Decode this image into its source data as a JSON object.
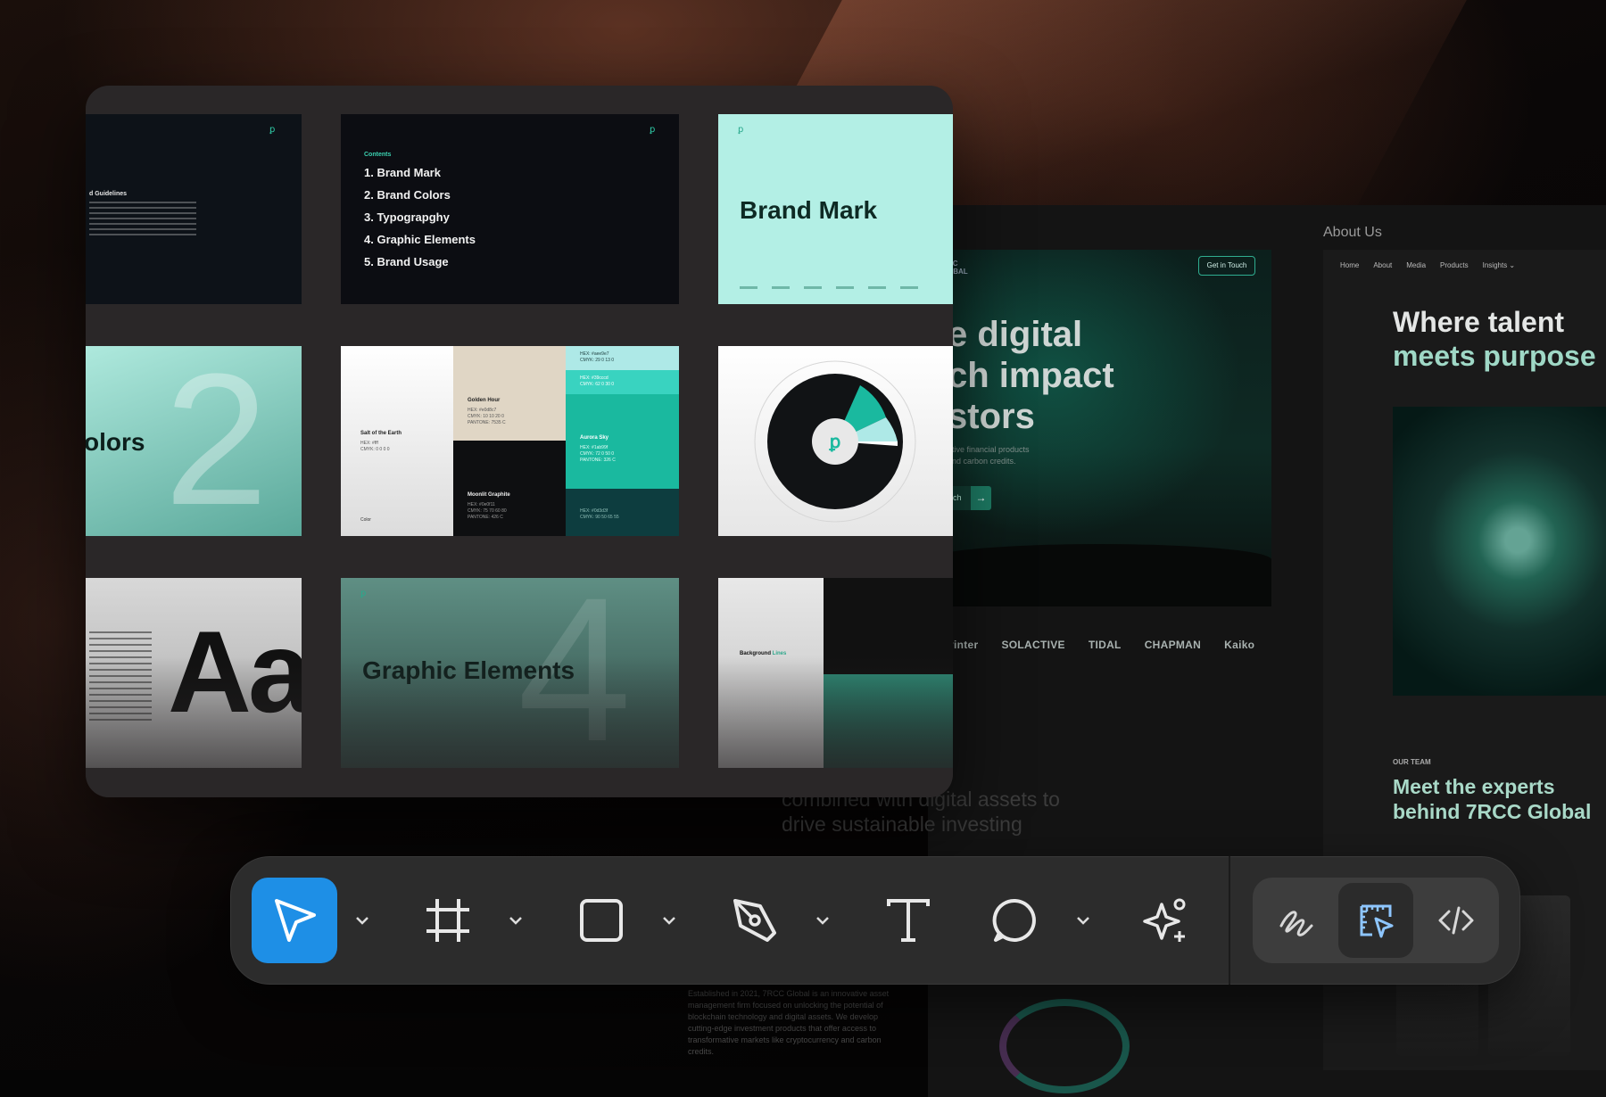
{
  "colors": {
    "accent": "#1e8fe6",
    "teal": "#2fc7a4",
    "mint": "#b3efe5"
  },
  "slides": {
    "intro": {
      "title": "d Guidelines"
    },
    "contents": {
      "label": "Contents",
      "items": [
        "1. Brand Mark",
        "2. Brand Colors",
        "3. Typograpghy",
        "4. Graphic Elements",
        "5. Brand Usage"
      ]
    },
    "brand_mark": {
      "title": "Brand Mark"
    },
    "colors": {
      "number": "2",
      "word": "olors"
    },
    "palette": {
      "salt": {
        "name": "Salt of the Earth",
        "hex": "HEX: #fff",
        "cmyk": "CMYK: 0 0 0 0"
      },
      "golden": {
        "name": "Golden Hour",
        "hex": "HEX: #e0d8c7",
        "cmyk": "CMYK: 10 10 20 0",
        "pantone": "PANTONE: 7535 C"
      },
      "moonlit": {
        "name": "Moonlit Graphite",
        "hex": "HEX: #0e0f11",
        "cmyk": "CMYK: 75 70 60 80",
        "pantone": "PANTONE: 426 C"
      },
      "aurora": {
        "name": "Aurora Sky",
        "hex": "HEX: #1ab99f",
        "cmyk": "CMYK: 72 0 50 0",
        "pantone": "PANTONE: 326 C"
      },
      "swatch1": "HEX: #aee9e7",
      "swatch1_cmyk": "CMYK: 29 0 13 0",
      "swatch2": "HEX: #39cccd",
      "swatch2_cmyk": "CMYK: 62 0 30 0",
      "swatch3": "HEX: #0d3d3f",
      "swatch3_cmyk": "CMYK: 90 50 65 55",
      "footer": "Color"
    },
    "type": {
      "glyph": "Aa"
    },
    "graphic": {
      "title": "Graphic Elements",
      "number": "4"
    },
    "background": {
      "title_a": "Background ",
      "title_b": "Lines"
    }
  },
  "website": {
    "logo_tag": "CC\nOBAL",
    "cta": "Get in Touch",
    "hero_title": "e digital\nch impact\nstors",
    "hero_sub": "ative financial products\nand carbon credits.",
    "hero_btn": "ch",
    "hero_arrow": "→",
    "partners": [
      "vinter",
      "SOLACTIVE",
      "TIDAL",
      "CHAPMAN",
      "Kaiko"
    ],
    "frontier": "new frontier\nedits are\ncombined with digital assets to\ndrive sustainable investing",
    "caption": "Established in 2021, 7RCC Global is an innovative asset management firm focused on unlocking the potential of blockchain technology and digital assets. We develop cutting-edge investment products that offer access to transformative markets like cryptocurrency and carbon credits.",
    "about_label": "About Us",
    "about_nav": [
      "Home",
      "About",
      "Media",
      "Products",
      "Insights ⌄"
    ],
    "talent_a": "Where talent",
    "talent_b": "meets purpose",
    "our_team": "OUR TEAM",
    "experts": "Meet the experts\nbehind 7RCC Global"
  },
  "toolbar": {
    "tools": [
      "move-tool",
      "frame-tool",
      "shape-tool",
      "pen-tool",
      "text-tool",
      "comment-tool",
      "ai-tool"
    ],
    "modes": [
      "draw-mode",
      "design-mode",
      "dev-mode"
    ]
  }
}
